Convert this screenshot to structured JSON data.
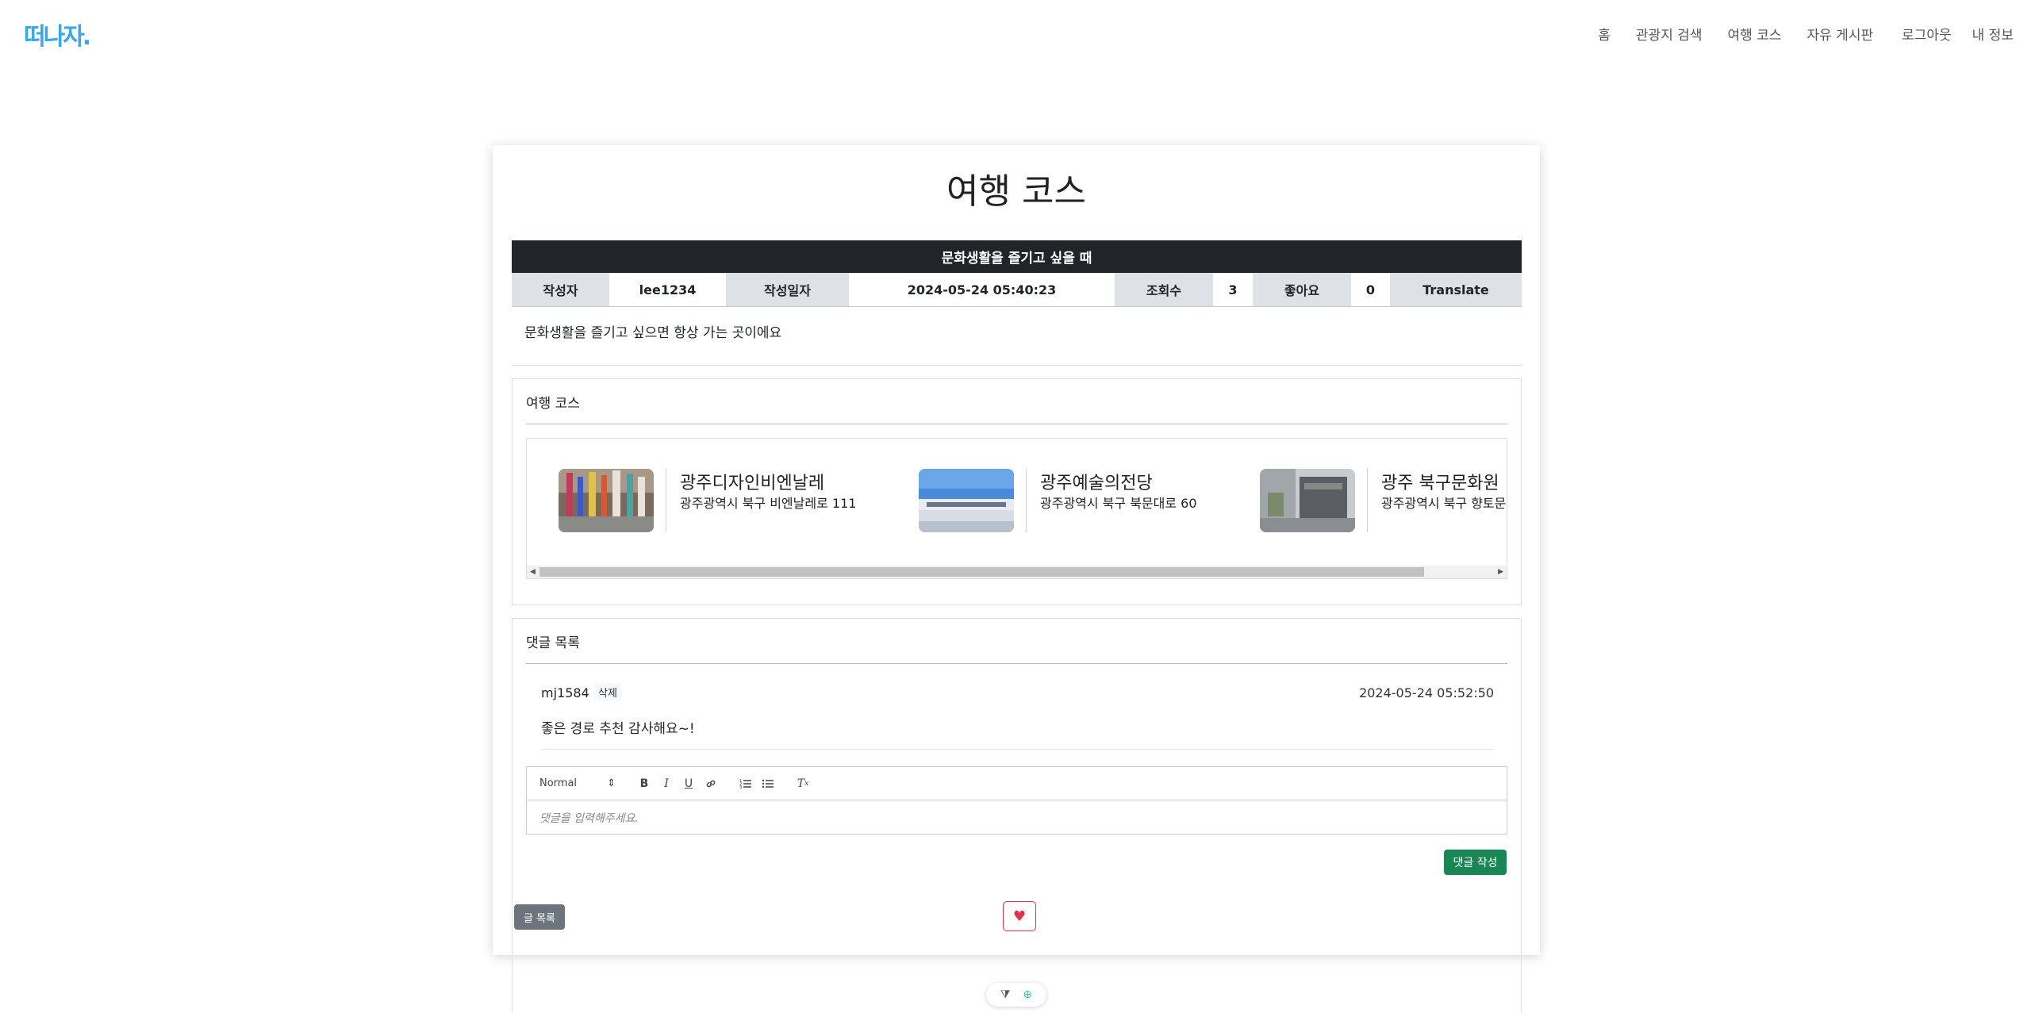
{
  "brand": {
    "logo_text": "떠나자.",
    "color": "#3aa8e8"
  },
  "nav": {
    "items": [
      "홈",
      "관광지 검색",
      "여행 코스",
      "자유 게시판",
      "로그아웃",
      "내 정보"
    ]
  },
  "page": {
    "title": "여행 코스"
  },
  "post": {
    "title": "문화생활을 즐기고 싶을 때",
    "author_label": "작성자",
    "author": "lee1234",
    "date_label": "작성일자",
    "date": "2024-05-24 05:40:23",
    "views_label": "조회수",
    "views": "3",
    "likes_label": "좋아요",
    "likes": "0",
    "translate_label": "Translate",
    "body": "문화생활을 즐기고 싶으면 항상 가는 곳이에요"
  },
  "course": {
    "section_title": "여행 코스",
    "items": [
      {
        "name": "광주디자인비엔날레",
        "address": "광주광역시 북구 비엔날레로 111"
      },
      {
        "name": "광주예술의전당",
        "address": "광주광역시 북구 북문대로 60"
      },
      {
        "name": "광주 북구문화원",
        "address": "광주광역시 북구 향토문화로"
      }
    ]
  },
  "comments": {
    "section_title": "댓글 목록",
    "items": [
      {
        "user": "mj1584",
        "delete_label": "삭제",
        "date": "2024-05-24 05:52:50",
        "text": "좋은 경로 추천 감사해요~!"
      }
    ],
    "editor": {
      "format_select": "Normal",
      "placeholder": "댓글을 입력해주세요."
    },
    "submit_label": "댓글 작성"
  },
  "footer_actions": {
    "list_label": "글 목록",
    "like_symbol": "♥"
  },
  "colors": {
    "dark": "#212529",
    "header_cell": "#dee2e6",
    "success": "#198754",
    "secondary": "#6c757d",
    "danger": "#dc3545"
  }
}
